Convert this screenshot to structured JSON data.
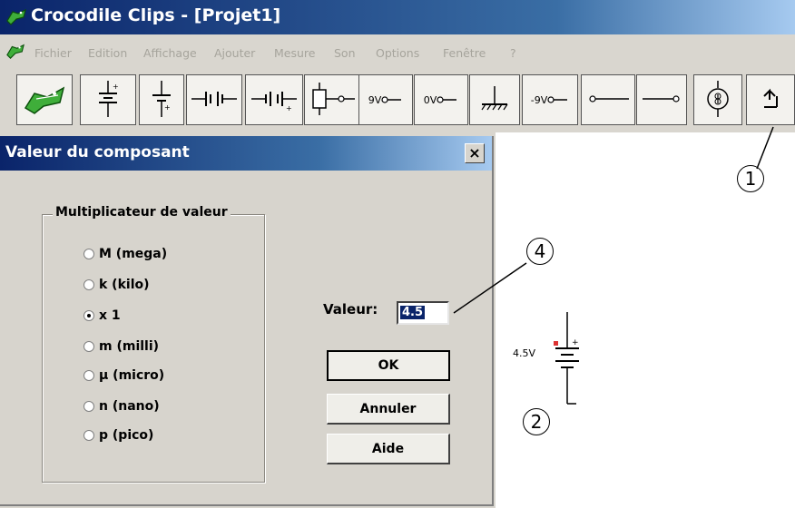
{
  "window": {
    "title": "Crocodile Clips - [Projet1]",
    "app_icon": "crocodile-icon"
  },
  "menu": {
    "items": [
      "Fichier",
      "Edition",
      "Affichage",
      "Ajouter",
      "Mesure",
      "Son",
      "Options",
      "Fenêtre",
      "?"
    ]
  },
  "toolbar": {
    "buttons": [
      {
        "icon": "crocodile-icon"
      },
      {
        "icon": "battery-vertical-icon"
      },
      {
        "icon": "battery-vertical-2-icon"
      },
      {
        "icon": "battery-horizontal-icon"
      },
      {
        "icon": "battery-horizontal-2-icon"
      },
      {
        "icon": "fuse-icon"
      },
      {
        "icon": "voltage-source-icon",
        "label": "9V"
      },
      {
        "icon": "voltage-source-icon",
        "label": "0V"
      },
      {
        "icon": "ground-icon"
      },
      {
        "icon": "voltage-source-icon",
        "label": "-9V"
      },
      {
        "icon": "wire-icon"
      },
      {
        "icon": "wire-end-icon"
      },
      {
        "icon": "current-source-icon"
      },
      {
        "icon": "arrow-up-icon"
      }
    ]
  },
  "dialog": {
    "title": "Valeur du composant",
    "close_label": "×",
    "group_label": "Multiplicateur de valeur",
    "options": [
      {
        "label": "M (mega)",
        "selected": false
      },
      {
        "label": "k (kilo)",
        "selected": false
      },
      {
        "label": "x 1",
        "selected": true
      },
      {
        "label": "m (milli)",
        "selected": false
      },
      {
        "label": "µ (micro)",
        "selected": false
      },
      {
        "label": "n (nano)",
        "selected": false
      },
      {
        "label": "p (pico)",
        "selected": false
      }
    ],
    "value_label": "Valeur:",
    "value": "4.5",
    "ok_label": "OK",
    "cancel_label": "Annuler",
    "help_label": "Aide"
  },
  "canvas": {
    "battery_label": "4.5V"
  },
  "callouts": [
    "1",
    "2",
    "4"
  ]
}
